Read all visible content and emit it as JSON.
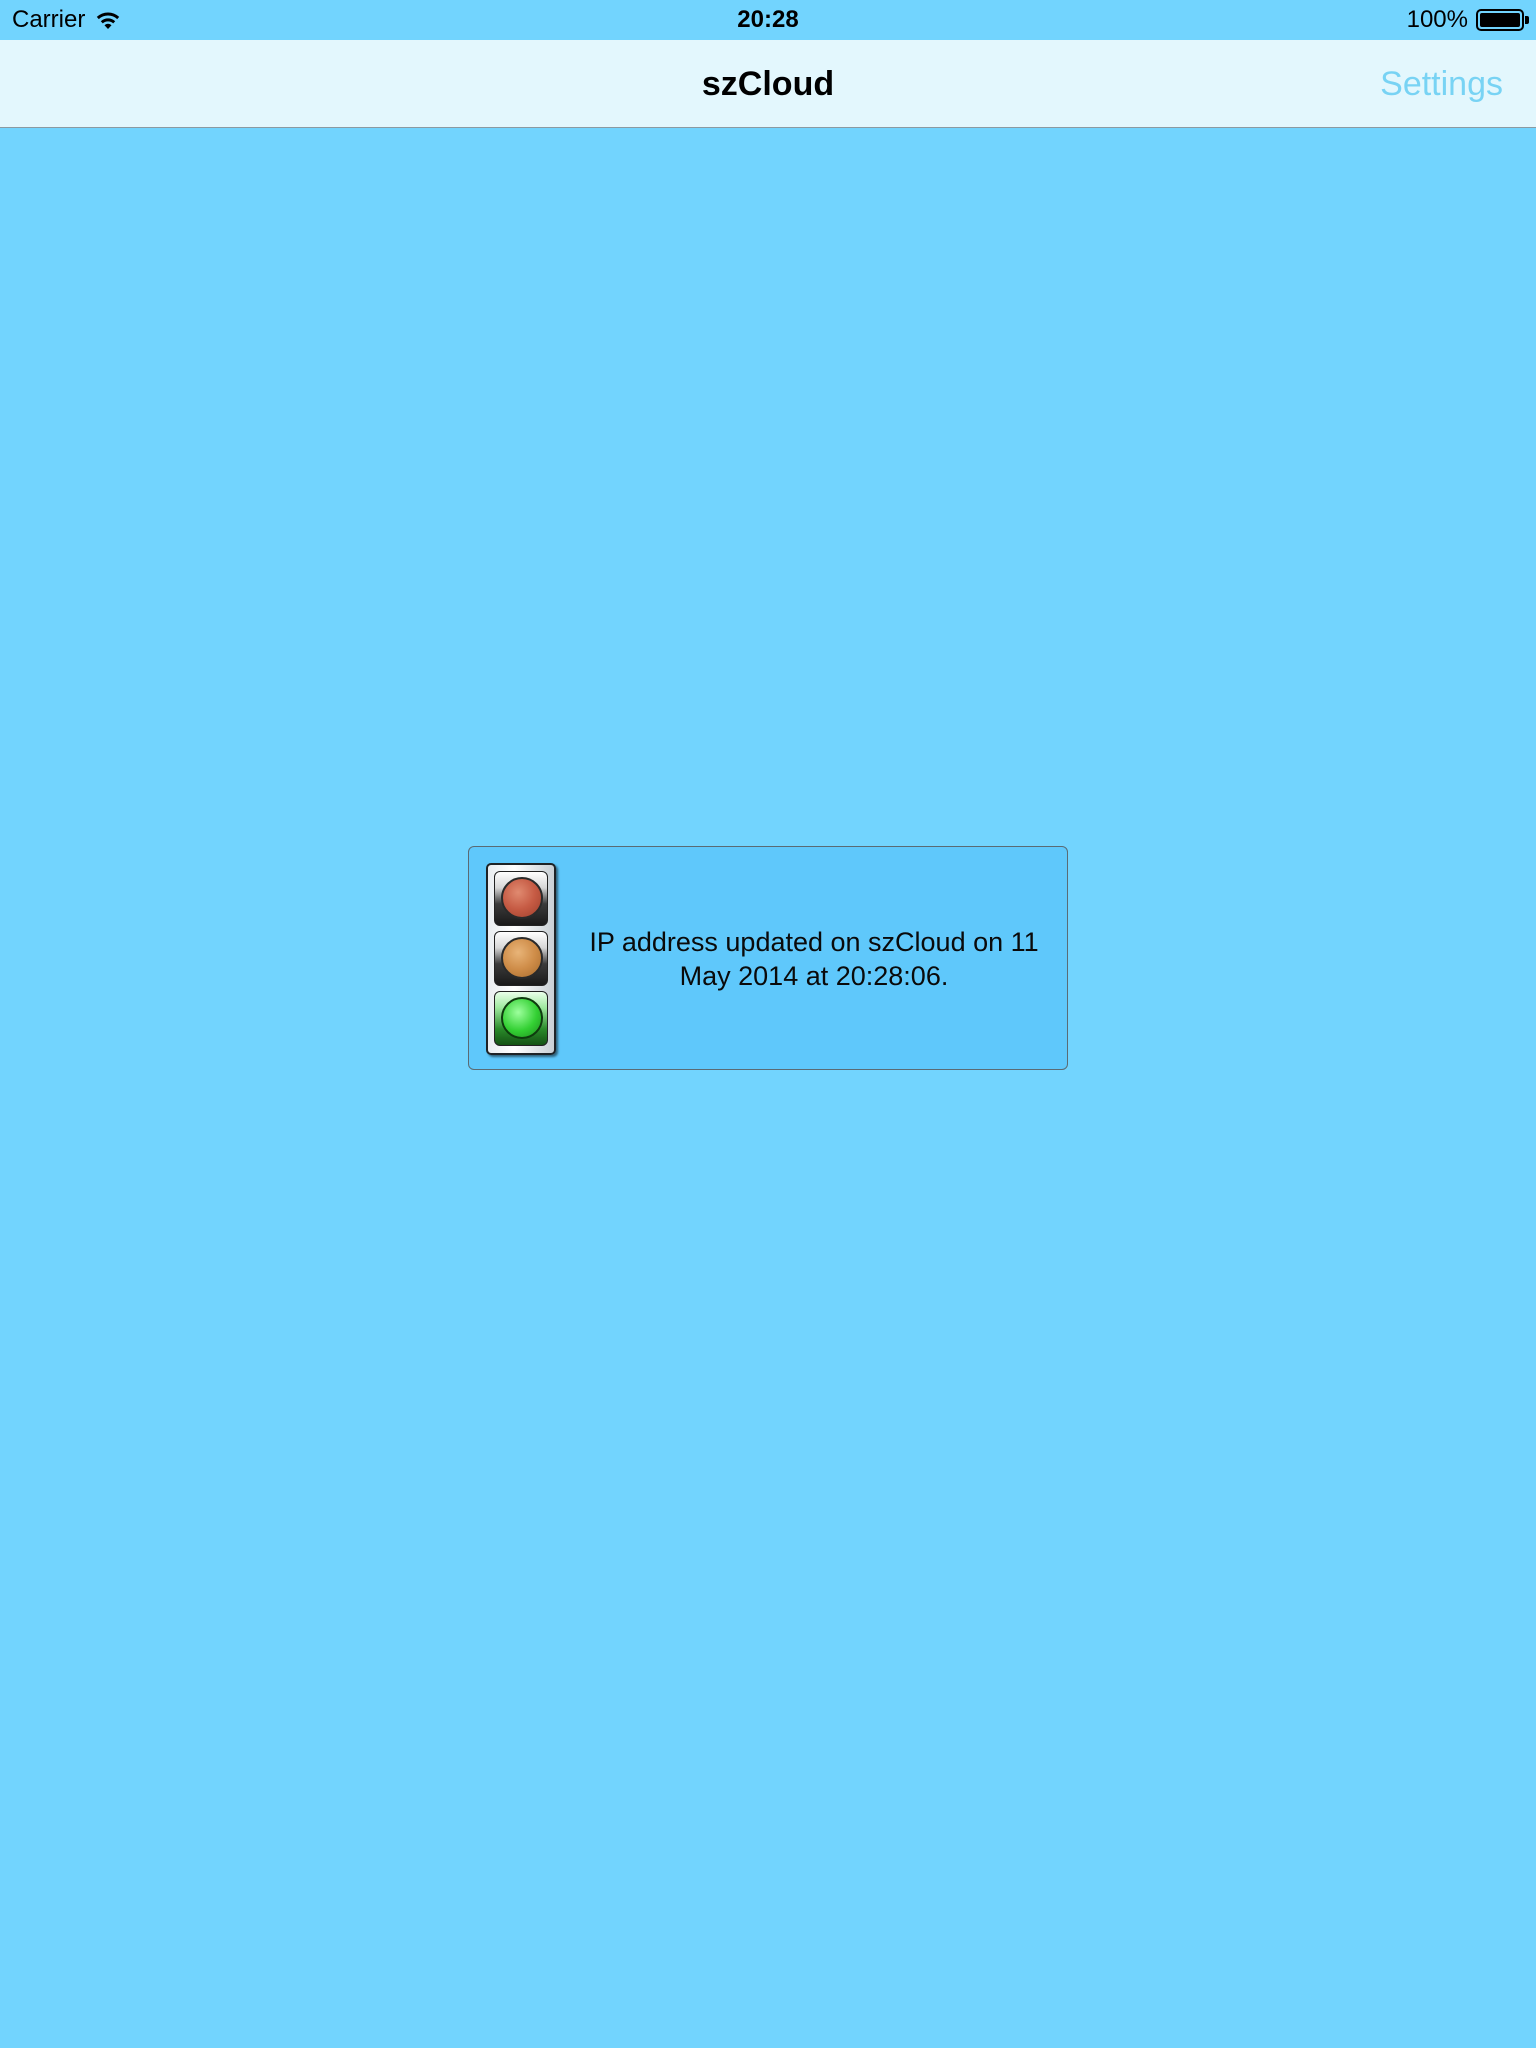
{
  "status_bar": {
    "carrier": "Carrier",
    "time": "20:28",
    "battery_percent": "100%",
    "battery_level": 1.0,
    "wifi_icon": "wifi-icon",
    "battery_icon": "battery-icon"
  },
  "nav_bar": {
    "title": "szCloud",
    "settings_label": "Settings",
    "settings_color": "#78d3f4"
  },
  "status_panel": {
    "indicator_icon": "traffic-light-icon",
    "active_light": "green",
    "message": "IP address updated on szCloud on 11 May 2014 at 20:28:06."
  },
  "colors": {
    "background": "#72d4fe",
    "nav_background": "#e3f7fd",
    "panel_background": "#5fc8fb"
  }
}
